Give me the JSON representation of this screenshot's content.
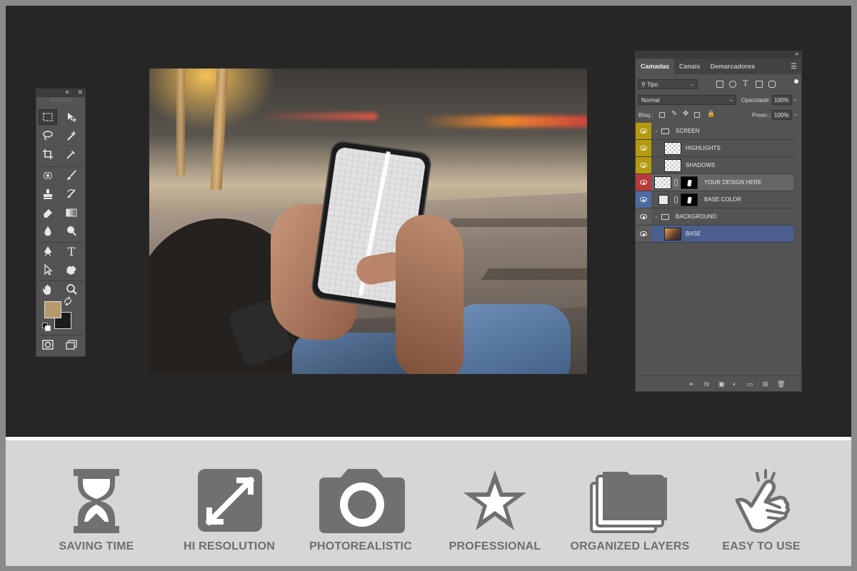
{
  "toolbar": {
    "collapse_glyph": "«",
    "close_glyph": "×",
    "tools": [
      {
        "name": "rectangular-marquee-icon"
      },
      {
        "name": "move-icon"
      },
      {
        "name": "lasso-icon"
      },
      {
        "name": "magic-wand-icon"
      },
      {
        "name": "crop-icon"
      },
      {
        "name": "eyedropper-icon"
      },
      {
        "name": "spot-healing-icon"
      },
      {
        "name": "brush-icon"
      },
      {
        "name": "clone-stamp-icon"
      },
      {
        "name": "history-brush-icon"
      },
      {
        "name": "eraser-icon"
      },
      {
        "name": "gradient-icon"
      },
      {
        "name": "blur-icon"
      },
      {
        "name": "dodge-icon"
      },
      {
        "name": "pen-icon"
      },
      {
        "name": "type-icon"
      },
      {
        "name": "path-selection-icon"
      },
      {
        "name": "custom-shape-icon"
      },
      {
        "name": "hand-icon"
      },
      {
        "name": "zoom-icon"
      }
    ],
    "type_tool_glyph": "T",
    "foreground_color": "#b59a6c",
    "background_color": "#1b1b1b"
  },
  "layers_panel": {
    "tabs": [
      {
        "label": "Camadas",
        "active": true
      },
      {
        "label": "Canais",
        "active": false
      },
      {
        "label": "Demarcadores",
        "active": false
      }
    ],
    "filter_kind": "Tipo",
    "blend_mode": "Normal",
    "opacity_label": "Opacidade:",
    "opacity_value": "100%",
    "lock_label": "Bloq.:",
    "fill_label": "Preen.:",
    "fill_value": "100%",
    "layers": [
      {
        "name": "SCREEN",
        "kind": "group",
        "color": "#b59a0d"
      },
      {
        "name": "HIGHLIGHTS",
        "kind": "layer",
        "color": "#b59a0d"
      },
      {
        "name": "SHADOWS",
        "kind": "layer",
        "color": "#b59a0d"
      },
      {
        "name": "YOUR DESIGN HERE",
        "kind": "smart-object",
        "color": "#b63a3a"
      },
      {
        "name": "BASE COLOR",
        "kind": "fill",
        "color": "#4d6aa0"
      },
      {
        "name": "BACKGROUND",
        "kind": "group",
        "color": null
      },
      {
        "name": "BASE",
        "kind": "image",
        "color": null,
        "selected": true
      }
    ],
    "bottom_icons": [
      "link-icon",
      "fx-icon",
      "mask-icon",
      "adjustment-icon",
      "folder-icon",
      "new-layer-icon",
      "trash-icon"
    ],
    "fx_label": "fx"
  },
  "features": [
    {
      "label": "SAVING TIME",
      "icon": "hourglass-icon"
    },
    {
      "label": "HI RESOLUTION",
      "icon": "expand-icon"
    },
    {
      "label": "PHOTOREALISTIC",
      "icon": "camera-icon"
    },
    {
      "label": "PROFESSIONAL",
      "icon": "star-icon"
    },
    {
      "label": "ORGANIZED LAYERS",
      "icon": "layers-stack-icon"
    },
    {
      "label": "EASY TO USE",
      "icon": "pointing-hand-icon"
    }
  ],
  "colors": {
    "workspace": "#262626",
    "panel": "#535353",
    "feature_strip": "#d6d6d6",
    "feature_icon": "#707070",
    "selected_layer": "#4a5f8e"
  }
}
